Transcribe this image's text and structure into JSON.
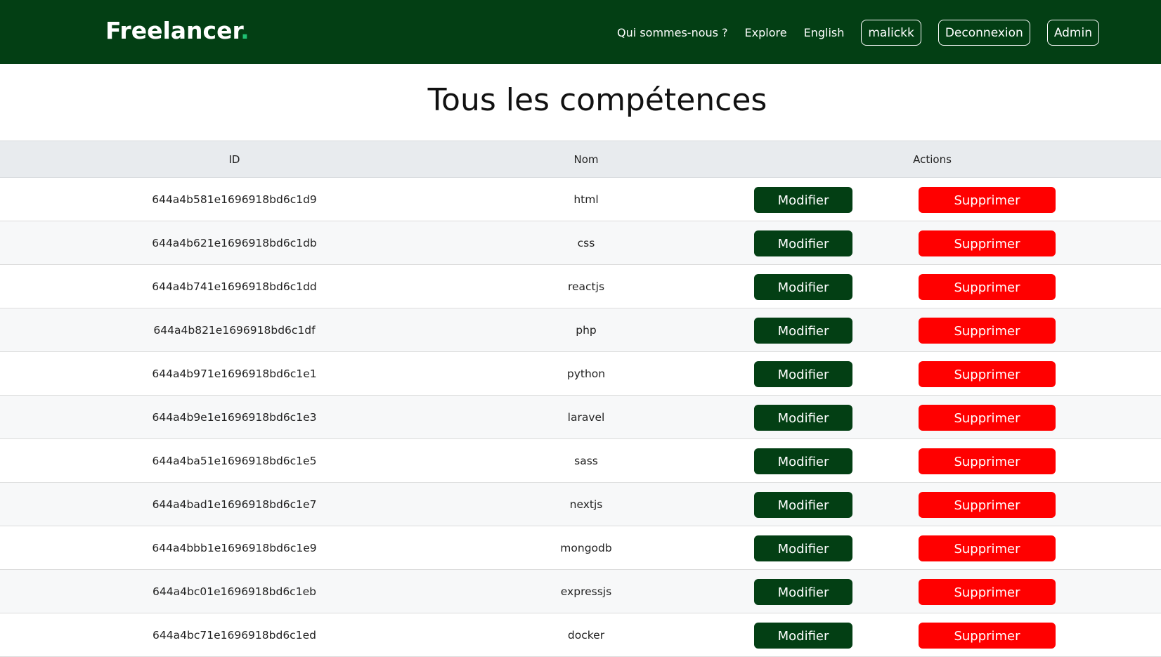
{
  "brand": {
    "name": "Freelancer",
    "dot": "."
  },
  "nav": {
    "about": "Qui sommes-nous ?",
    "explore": "Explore",
    "language": "English",
    "user": "malickk",
    "logout": "Deconnexion",
    "admin": "Admin"
  },
  "page": {
    "title": "Tous les compétences"
  },
  "table": {
    "headers": {
      "id": "ID",
      "name": "Nom",
      "actions": "Actions"
    },
    "edit_label": "Modifier",
    "delete_label": "Supprimer",
    "rows": [
      {
        "id": "644a4b581e1696918bd6c1d9",
        "name": "html"
      },
      {
        "id": "644a4b621e1696918bd6c1db",
        "name": "css"
      },
      {
        "id": "644a4b741e1696918bd6c1dd",
        "name": "reactjs"
      },
      {
        "id": "644a4b821e1696918bd6c1df",
        "name": "php"
      },
      {
        "id": "644a4b971e1696918bd6c1e1",
        "name": "python"
      },
      {
        "id": "644a4b9e1e1696918bd6c1e3",
        "name": "laravel"
      },
      {
        "id": "644a4ba51e1696918bd6c1e5",
        "name": "sass"
      },
      {
        "id": "644a4bad1e1696918bd6c1e7",
        "name": "nextjs"
      },
      {
        "id": "644a4bbb1e1696918bd6c1e9",
        "name": "mongodb"
      },
      {
        "id": "644a4bc01e1696918bd6c1eb",
        "name": "expressjs"
      },
      {
        "id": "644a4bc71e1696918bd6c1ed",
        "name": "docker"
      }
    ]
  },
  "colors": {
    "primary": "#033f14",
    "danger": "#ff0000",
    "accent": "#1fc173",
    "header_bg": "#e8ebee"
  }
}
